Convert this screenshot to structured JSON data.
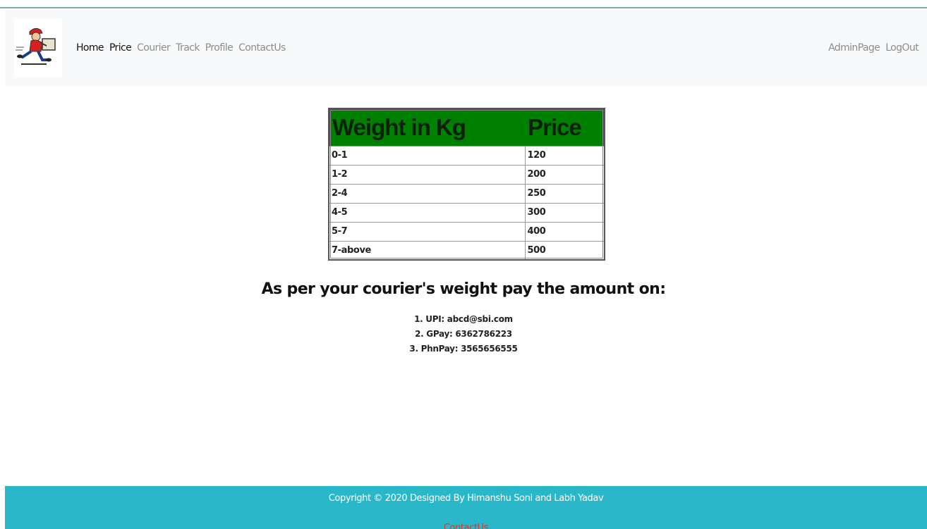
{
  "navbar": {
    "logo_icon": "courier-delivery-man-logo",
    "left_links": [
      {
        "label": "Home",
        "active": true
      },
      {
        "label": "Price",
        "active": true
      },
      {
        "label": "Courier",
        "active": false
      },
      {
        "label": "Track",
        "active": false
      },
      {
        "label": "Profile",
        "active": false
      },
      {
        "label": "ContactUs",
        "active": false
      }
    ],
    "right_links": [
      {
        "label": "AdminPage"
      },
      {
        "label": "LogOut"
      }
    ]
  },
  "price_table": {
    "headers": [
      "Weight in Kg",
      "Price"
    ],
    "header_color": "#008000",
    "rows": [
      [
        "0-1",
        "120"
      ],
      [
        "1-2",
        "200"
      ],
      [
        "2-4",
        "250"
      ],
      [
        "4-5",
        "300"
      ],
      [
        "5-7",
        "400"
      ],
      [
        "7-above",
        "500"
      ]
    ]
  },
  "payment": {
    "heading": "As per your courier's weight pay the amount on:",
    "methods": [
      "1. UPI: abcd@sbi.com",
      "2. GPay: 6362786223",
      "3. PhnPay: 3565656555"
    ]
  },
  "footer": {
    "copyright": "Copyright © 2020 Designed By Himanshu Soni and Labh Yadav",
    "contact_link": "ContactUs",
    "background_color": "#2ab7ca"
  }
}
